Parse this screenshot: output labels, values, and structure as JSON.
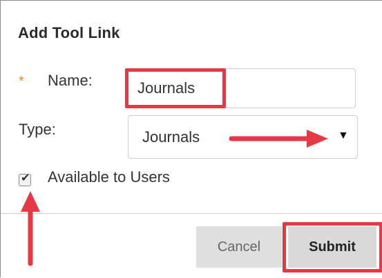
{
  "dialog": {
    "title": "Add Tool Link",
    "divider_visible": true
  },
  "form": {
    "required_marker": "*",
    "name": {
      "label": "Name:",
      "value": "Journals",
      "required": true
    },
    "type": {
      "label": "Type:",
      "selected": "Journals",
      "caret": "▼"
    },
    "available_to_users": {
      "label": "Available to Users",
      "checked": true,
      "checkmark": "✔"
    }
  },
  "actions": {
    "cancel_label": "Cancel",
    "submit_label": "Submit"
  },
  "annotations": {
    "highlight_color": "#e63946",
    "highlights": [
      "name-input",
      "submit-button"
    ],
    "arrows": [
      "type-select",
      "available-to-users-checkbox"
    ]
  },
  "theme": {
    "required_color": "#f08a24",
    "text_color": "#333333",
    "button_bg": "#dfdfdf",
    "border_color": "#cfcfcf"
  }
}
